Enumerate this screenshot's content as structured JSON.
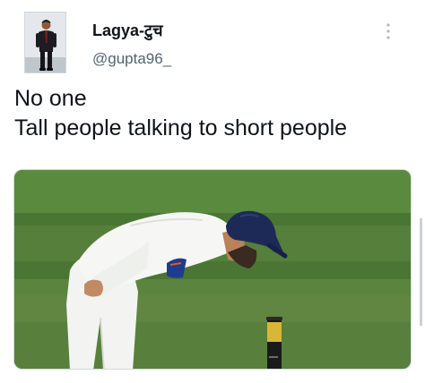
{
  "user": {
    "display_name": "Lagya-टुच",
    "handle": "@gupta96_"
  },
  "tweet": {
    "lines": [
      "No one",
      "Tall people talking to short people"
    ]
  },
  "icons": {
    "more": "more-vertical-icon"
  },
  "colors": {
    "text": "#0f1419",
    "secondary_text": "#536471",
    "pitch_green": "#4f7a35"
  }
}
